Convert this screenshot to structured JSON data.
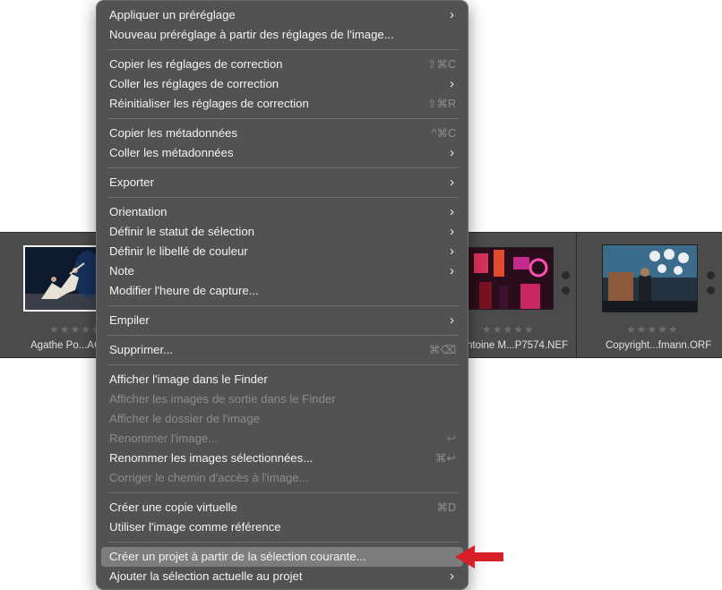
{
  "filmstrip": {
    "photos": [
      {
        "filename": "Agathe Po...AC",
        "rating_stars": 0
      },
      {
        "filename": "ntoine M...P7574.NEF",
        "rating_stars": 0
      },
      {
        "filename": "Copyright...fmann.ORF",
        "rating_stars": 0
      }
    ],
    "stars_glyph": "★★★★★"
  },
  "menu": {
    "apply_preset": "Appliquer un préréglage",
    "new_preset": "Nouveau préréglage à partir des réglages de l'image...",
    "copy_adjustments": "Copier les réglages de correction",
    "copy_adjustments_shortcut": "⇧⌘C",
    "paste_adjustments": "Coller les réglages de correction",
    "reset_adjustments": "Réinitialiser les réglages de correction",
    "reset_adjustments_shortcut": "⇧⌘R",
    "copy_metadata": "Copier les métadonnées",
    "copy_metadata_shortcut": "^⌘C",
    "paste_metadata": "Coller les métadonnées",
    "export": "Exporter",
    "orientation": "Orientation",
    "set_selection_status": "Définir le statut de sélection",
    "set_color_label": "Définir le libellé de couleur",
    "note": "Note",
    "edit_capture_time": "Modifier l'heure de capture...",
    "stack": "Empiler",
    "delete": "Supprimer...",
    "delete_shortcut": "⌘⌫",
    "show_in_finder": "Afficher l'image dans le Finder",
    "show_output_in_finder": "Afficher les images de sortie dans le Finder",
    "show_image_folder": "Afficher le dossier de l'image",
    "rename_image": "Renommer l'image...",
    "rename_image_shortcut": "↩",
    "rename_selected": "Renommer les images sélectionnées...",
    "rename_selected_shortcut": "⌘↩",
    "fix_path": "Corriger le chemin d'accès à l'image...",
    "create_virtual_copy": "Créer une copie virtuelle",
    "create_virtual_copy_shortcut": "⌘D",
    "use_as_reference": "Utiliser l'image comme référence",
    "create_project": "Créer un projet à partir de la sélection courante...",
    "add_to_project": "Ajouter la sélection actuelle au projet",
    "chevron": "›"
  },
  "colors": {
    "menu_bg": "#525252",
    "highlight": "#7d7d7d",
    "arrow": "#d61f26"
  }
}
